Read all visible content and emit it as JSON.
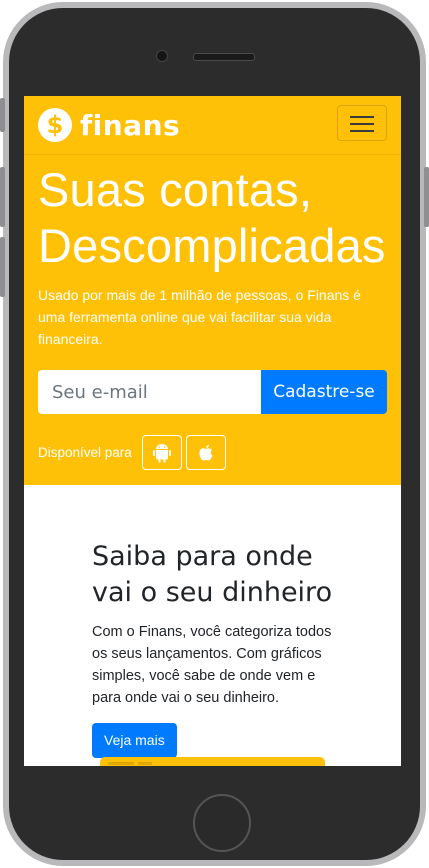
{
  "brand": {
    "logo_symbol": "$",
    "name": "finans",
    "accent_color": "#ffc107",
    "primary_color": "#007bff"
  },
  "navbar": {
    "menu_icon": "hamburger-icon"
  },
  "hero": {
    "headline_line1": "Suas contas,",
    "headline_line2": "Descomplicadas",
    "description": "Usado por mais de 1 milhão de pessoas, o Finans é uma ferramenta online que vai facilitar sua vida financeira.",
    "email_placeholder": "Seu e-mail",
    "signup_label": "Cadastre-se",
    "available_label": "Disponível para",
    "stores": [
      "android-icon",
      "apple-icon"
    ]
  },
  "feature": {
    "title": "Saiba para onde vai o seu dinheiro",
    "text": "Com o Finans, você categoriza todos os seus lançamentos. Com gráficos simples, você sabe de onde vem e para onde vai o seu dinheiro.",
    "button_label": "Veja mais"
  }
}
